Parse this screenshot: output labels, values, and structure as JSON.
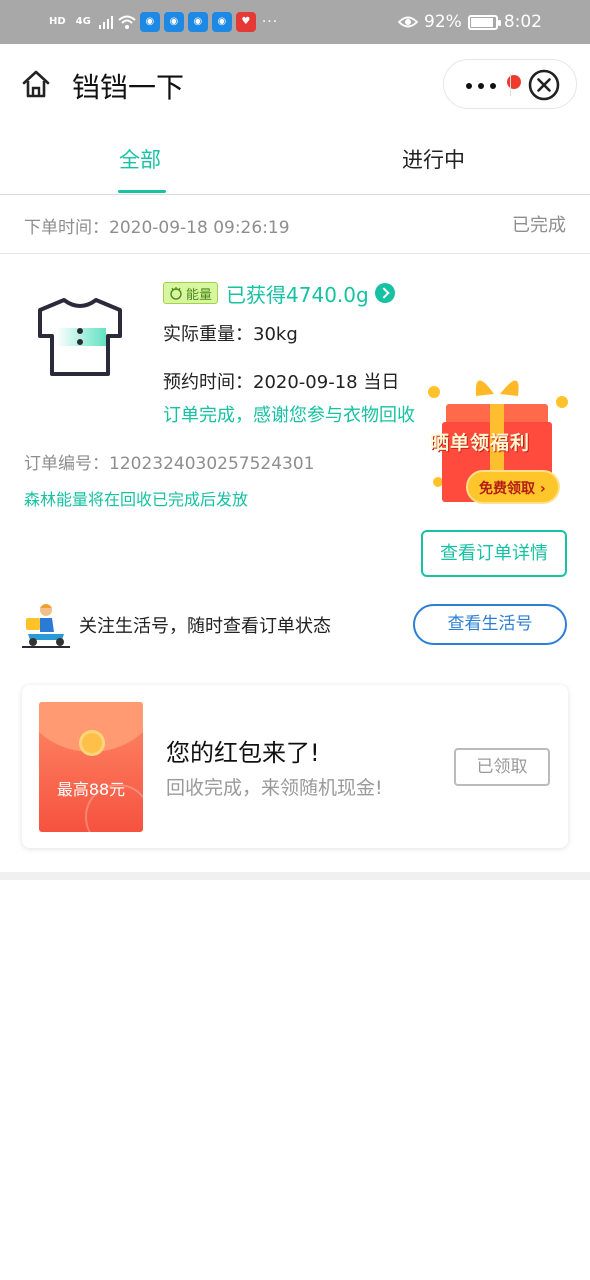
{
  "status_bar": {
    "left_chips": [
      "HD",
      "4G"
    ],
    "battery": "92%",
    "battery_level": 0.92,
    "time": "8:02",
    "dots": "···"
  },
  "header": {
    "title": "铛铛一下",
    "icons": [
      "home-icon",
      "more-icon",
      "close-icon"
    ]
  },
  "tabs": [
    {
      "label": "全部",
      "active": true
    },
    {
      "label": "进行中",
      "active": false
    }
  ],
  "order": {
    "time_label": "下单时间：2020-09-18 09:26:19",
    "status": "已完成",
    "energy_badge": "能量",
    "energy_earned": "已获得4740.0g",
    "weight": "实际重量：30kg",
    "appointment": "预约时间：2020-09-18 当日",
    "thanks": "订单完成，感谢您参与衣物回收",
    "order_no": "订单编号：1202324030257524301",
    "energy_note": "森林能量将在回收已完成后发放",
    "detail_button": "查看订单详情"
  },
  "promo": {
    "title": "晒单领福利",
    "button": "免费领取 ›"
  },
  "follow": {
    "text": "关注生活号，随时查看订单状态",
    "button": "查看生活号"
  },
  "red_packet": {
    "amount": "最高88元",
    "title": "您的红包来了!",
    "subtitle": "回收完成，来领随机现金!",
    "button": "已领取"
  },
  "colors": {
    "accent": "#17c2a3",
    "link_blue": "#2d7fd6",
    "muted": "#8e8e8e",
    "packet_red": "#f5523f"
  }
}
